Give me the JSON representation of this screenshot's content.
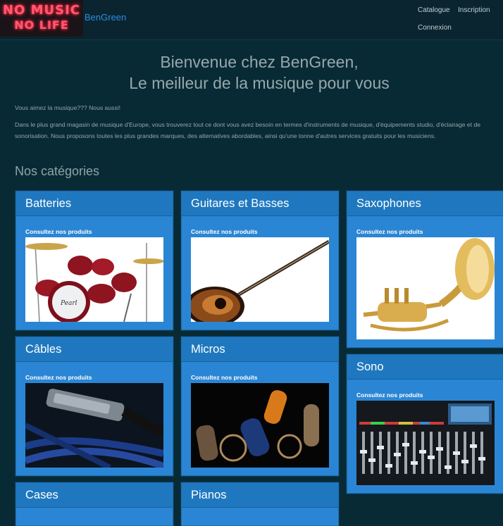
{
  "header": {
    "logo_lines": [
      "NO MUSIC",
      "NO LIFE"
    ],
    "brand": "BenGreen",
    "nav": {
      "catalogue": "Catalogue",
      "inscription": "Inscription",
      "connexion": "Connexion"
    }
  },
  "hero": {
    "title_line1": "Bienvenue chez BenGreen,",
    "title_line2": "Le meilleur de la musique pour vous"
  },
  "intro": {
    "p1": "Vous aimez la musique??? Nous aussi!",
    "p2": "Dans le plus grand magasin de musique d'Europe, vous trouverez tout ce dont vous avez besoin en termes d'instruments de musique, d'équipements studio, d'éclairage et de sonorisation. Nous proposons toutes les plus grandes marques, des alternatives abordables, ainsi qu'une tonne d'autres services gratuits pour les musiciens."
  },
  "categories": {
    "title": "Nos catégories",
    "link_label": "Consultez nos produits",
    "items": [
      {
        "name": "Batteries",
        "icon": "drum-kit-image"
      },
      {
        "name": "Guitares et Basses",
        "icon": "guitar-image"
      },
      {
        "name": "Saxophones",
        "icon": "brass-instrument-image"
      },
      {
        "name": "Câbles",
        "icon": "cable-image"
      },
      {
        "name": "Micros",
        "icon": "microphone-image"
      },
      {
        "name": "Sono",
        "icon": "mixing-console-image"
      },
      {
        "name": "Cases",
        "icon": "case-image"
      },
      {
        "name": "Pianos",
        "icon": "piano-image"
      }
    ]
  },
  "colors": {
    "background": "#082a35",
    "card": "#2a86d4",
    "card_header": "#1f78bf",
    "brand_link": "#2e8de0"
  }
}
